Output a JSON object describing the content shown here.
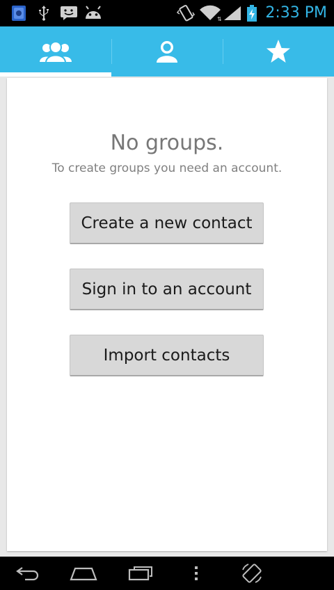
{
  "status_bar": {
    "time": "2:33 PM",
    "icons": [
      "app-notification-icon",
      "usb-icon",
      "sms-icon",
      "android-debug-icon",
      "vibrate-icon",
      "wifi-icon",
      "signal-icon",
      "battery-charging-icon"
    ]
  },
  "tabs": [
    {
      "name": "groups",
      "icon": "groups-icon",
      "selected": true
    },
    {
      "name": "all-contacts",
      "icon": "person-icon",
      "selected": false
    },
    {
      "name": "favorites",
      "icon": "star-icon",
      "selected": false
    }
  ],
  "empty_state": {
    "title": "No groups.",
    "subtitle": "To create groups you need an account."
  },
  "buttons": {
    "create_contact": "Create a new contact",
    "sign_in": "Sign in to an account",
    "import_contacts": "Import contacts"
  },
  "nav_bar": {
    "icons": [
      "back-icon",
      "home-icon",
      "recent-apps-icon",
      "menu-icon",
      "rotation-icon"
    ]
  },
  "colors": {
    "accent": "#33b5e5",
    "tab_bar": "#38bbe8",
    "button": "#d8d8d8"
  }
}
